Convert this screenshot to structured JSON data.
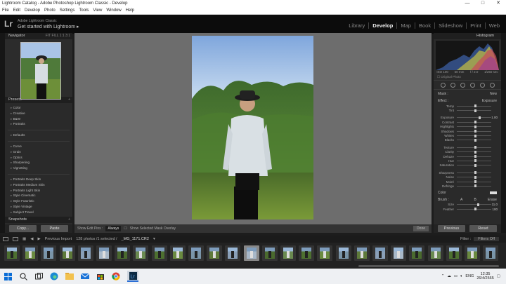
{
  "window": {
    "title": "Lightroom Catalog - Adobe Photoshop Lightroom Classic - Develop",
    "controls": [
      "—",
      "□",
      "✕"
    ]
  },
  "menu": [
    "File",
    "Edit",
    "Develop",
    "Photo",
    "Settings",
    "Tools",
    "View",
    "Window",
    "Help"
  ],
  "identity": {
    "logo": "Lr",
    "small": "Adobe Lightroom Classic",
    "big": "Get started with Lightroom ▸"
  },
  "modules": [
    "Library",
    "Develop",
    "Map",
    "Book",
    "Slideshow",
    "Print",
    "Web"
  ],
  "left": {
    "navigator": {
      "title": "Navigator",
      "opts": "FIT  FILL  1:1  3:1"
    },
    "presets": {
      "title": "Presets",
      "group1": [
        "Color",
        "Creative",
        "B&W",
        "Portraits"
      ],
      "group2": [
        "Defaults"
      ],
      "group3": [
        "Curve",
        "Grain",
        "Optics",
        "Sharpening",
        "Vignetting"
      ],
      "group4": [
        "Portraits Deep Skin",
        "Portraits Medium Skin",
        "Portraits Light Skin",
        "Style Cinematic",
        "Style Futuristic",
        "Style Vintage",
        "Subject Travel"
      ]
    },
    "snapshots": "Snapshots",
    "copy": "Copy...",
    "paste": "Paste"
  },
  "right": {
    "histogram": {
      "title": "Histogram",
      "info": [
        "ISO 100",
        "50 mm",
        "f / 2.0",
        "1/250 sec"
      ]
    },
    "original_photo": "Original Photo",
    "mask": {
      "label": "Mask :",
      "value": "New"
    },
    "effect": {
      "label": "Effect :",
      "value": "Exposure"
    },
    "sliders_a": [
      {
        "label": "Temp",
        "pos": 0.5
      },
      {
        "label": "Tint",
        "pos": 0.5
      }
    ],
    "sliders_b": [
      {
        "label": "Exposure",
        "pos": 0.64,
        "value": "1.00"
      },
      {
        "label": "Contrast",
        "pos": 0.5
      },
      {
        "label": "Highlights",
        "pos": 0.5
      },
      {
        "label": "Shadows",
        "pos": 0.5
      },
      {
        "label": "Whites",
        "pos": 0.5
      },
      {
        "label": "Blacks",
        "pos": 0.5
      }
    ],
    "sliders_c": [
      {
        "label": "Texture",
        "pos": 0.5
      },
      {
        "label": "Clarity",
        "pos": 0.5
      },
      {
        "label": "Dehaze",
        "pos": 0.5
      },
      {
        "label": "Hue",
        "pos": 0.5
      },
      {
        "label": "Saturation",
        "pos": 0.5
      }
    ],
    "sliders_d": [
      {
        "label": "Sharpness",
        "pos": 0.5
      },
      {
        "label": "Noise",
        "pos": 0.5
      },
      {
        "label": "Moiré",
        "pos": 0.5
      },
      {
        "label": "Defringe",
        "pos": 0.5
      }
    ],
    "color_label": "Color",
    "brush": {
      "label": "Brush :",
      "a": "A",
      "b": "B",
      "erase": "Erase"
    },
    "sliders_e": [
      {
        "label": "Size",
        "pos": 0.6,
        "value": "11.0"
      },
      {
        "label": "Feather",
        "pos": 0.5,
        "value": "100"
      }
    ],
    "previous": "Previous",
    "reset": "Reset"
  },
  "toolbar": {
    "show_edit_pins": "Show Edit Pins :",
    "always": "Always",
    "overlay": "Show Selected Mask Overlay",
    "done": "Done"
  },
  "filmstrip": {
    "pages": "1  2",
    "source": "Previous Import",
    "count": "128 photos /1 selected /",
    "file": "_MG_1171.CR2",
    "filter_label": "Filter :",
    "filter_value": "Filters Off"
  },
  "taskbar": {
    "lang": "ENG",
    "time": "12:35",
    "date": "26/4/2565"
  }
}
